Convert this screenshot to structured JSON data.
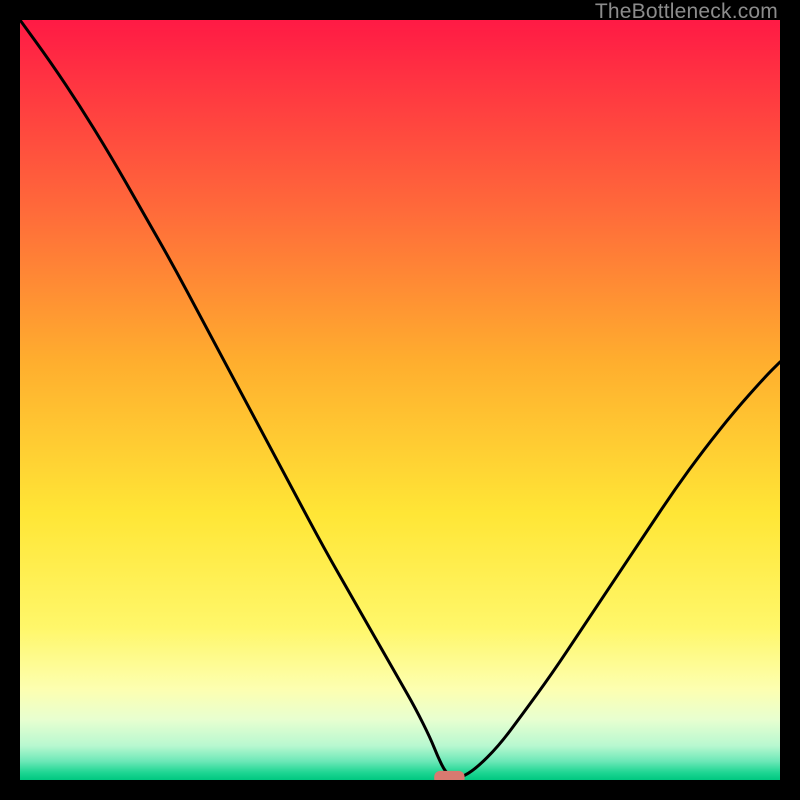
{
  "watermark": "TheBottleneck.com",
  "chart_data": {
    "type": "line",
    "title": "",
    "xlabel": "",
    "ylabel": "",
    "xlim": [
      0,
      100
    ],
    "ylim": [
      0,
      100
    ],
    "grid": false,
    "legend": false,
    "gradient_stops": [
      {
        "offset": 0.0,
        "color": "#ff1a45"
      },
      {
        "offset": 0.25,
        "color": "#ff6a3a"
      },
      {
        "offset": 0.45,
        "color": "#ffae2e"
      },
      {
        "offset": 0.65,
        "color": "#ffe636"
      },
      {
        "offset": 0.8,
        "color": "#fff76a"
      },
      {
        "offset": 0.88,
        "color": "#fdffb0"
      },
      {
        "offset": 0.92,
        "color": "#e8ffd0"
      },
      {
        "offset": 0.955,
        "color": "#b8f8d0"
      },
      {
        "offset": 0.975,
        "color": "#6ee8b8"
      },
      {
        "offset": 0.99,
        "color": "#1fd693"
      },
      {
        "offset": 1.0,
        "color": "#00c880"
      }
    ],
    "series": [
      {
        "name": "bottleneck-curve",
        "x": [
          0,
          4,
          8,
          12,
          16,
          20,
          24,
          28,
          32,
          36,
          40,
          44,
          48,
          50,
          52,
          54,
          55,
          56,
          57,
          58,
          60,
          63,
          66,
          70,
          74,
          78,
          82,
          86,
          90,
          94,
          98,
          100
        ],
        "y": [
          100,
          94.5,
          88.5,
          82.0,
          75.0,
          68.0,
          60.5,
          53.0,
          45.5,
          38.0,
          30.5,
          23.5,
          16.5,
          13.0,
          9.5,
          5.5,
          3.0,
          1.0,
          0.3,
          0.3,
          1.5,
          4.5,
          8.5,
          14.0,
          20.0,
          26.0,
          32.0,
          38.0,
          43.5,
          48.5,
          53.0,
          55.0
        ]
      }
    ],
    "marker": {
      "name": "optimal-marker",
      "x": 56.5,
      "y": 0.3,
      "width": 4.0,
      "height": 1.8,
      "color": "#d87a70"
    }
  }
}
